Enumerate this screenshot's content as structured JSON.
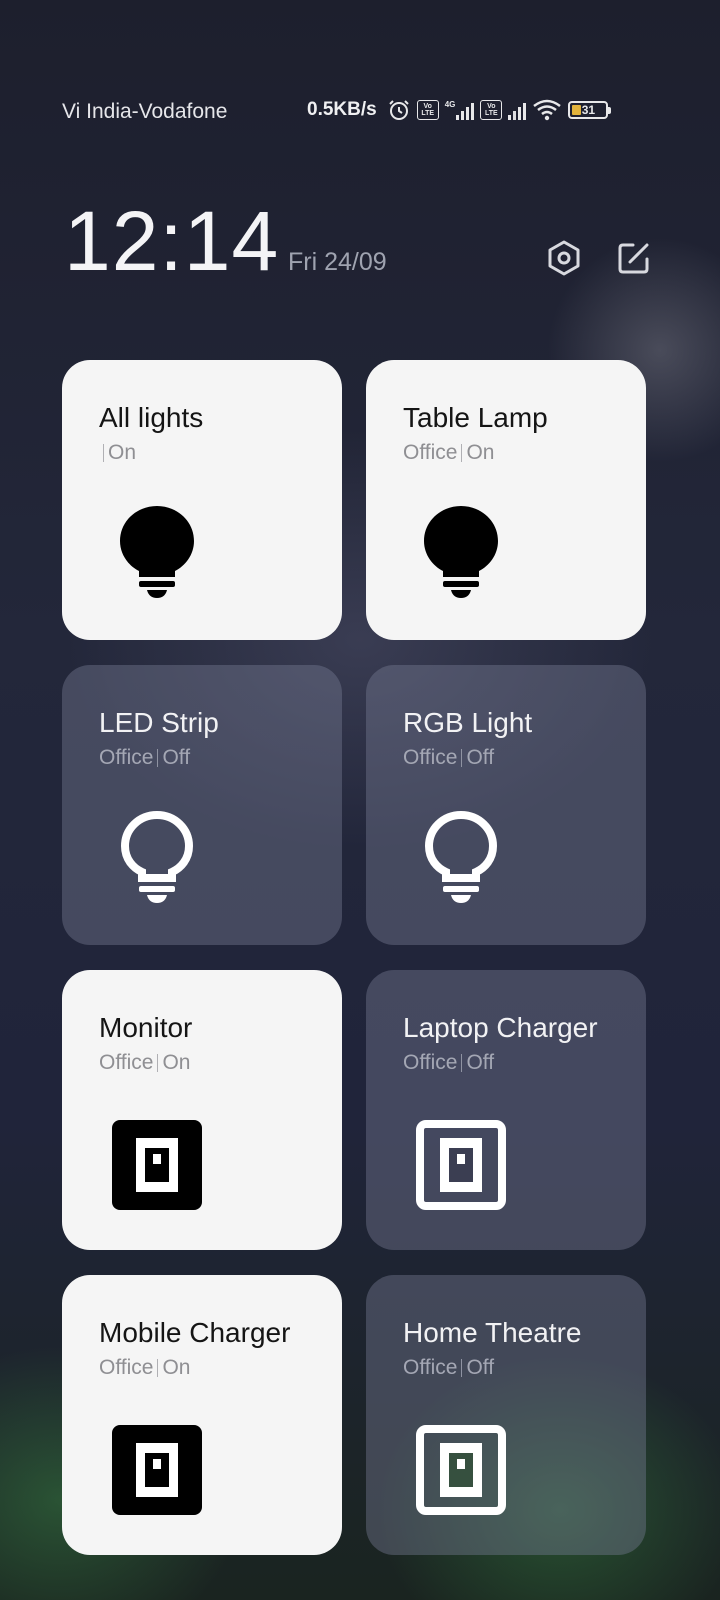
{
  "status_bar": {
    "carrier": "Vi India-Vodafone",
    "net_speed": "0.5KB/s",
    "volte_label": "Vo LTE",
    "network_type": "4G",
    "battery_level": "31",
    "icons": [
      "alarm-icon",
      "volte-icon",
      "signal-icon",
      "wifi-icon",
      "battery-icon"
    ]
  },
  "header": {
    "time": "12:14",
    "date": "Fri 24/09",
    "settings_icon": "hexagon-settings-icon",
    "edit_icon": "edit-icon"
  },
  "colors": {
    "tile_on": "#f5f5f5",
    "tile_off": "#5a5d72",
    "battery_fill": "#e2b33c"
  },
  "devices": [
    {
      "name": "All lights",
      "room": "",
      "status": "On",
      "icon": "bulb-icon"
    },
    {
      "name": "Table Lamp",
      "room": "Office",
      "status": "On",
      "icon": "bulb-icon"
    },
    {
      "name": "LED Strip",
      "room": "Office",
      "status": "Off",
      "icon": "bulb-outline-icon"
    },
    {
      "name": "RGB Light",
      "room": "Office",
      "status": "Off",
      "icon": "bulb-outline-icon"
    },
    {
      "name": "Monitor",
      "room": "Office",
      "status": "On",
      "icon": "switch-icon"
    },
    {
      "name": "Laptop Charger",
      "room": "Office",
      "status": "Off",
      "icon": "switch-outline-icon"
    },
    {
      "name": "Mobile Charger",
      "room": "Office",
      "status": "On",
      "icon": "switch-icon"
    },
    {
      "name": "Home Theatre",
      "room": "Office",
      "status": "Off",
      "icon": "switch-outline-icon"
    }
  ]
}
